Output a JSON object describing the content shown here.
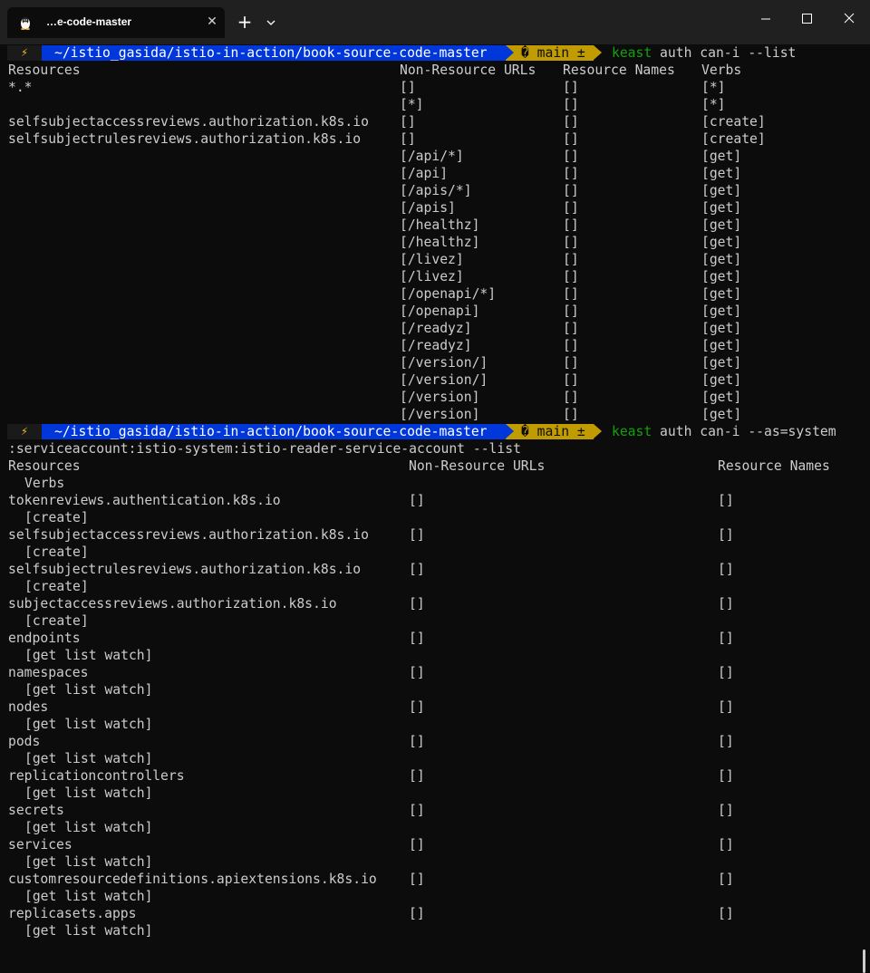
{
  "window": {
    "tab_title": "…e-code-master",
    "tab_icon": "linux-penguin-icon"
  },
  "prompt": {
    "bolt": "⚡",
    "path": "~/istio_gasida/istio-in-action/book-source-code-master",
    "git": "� main ±"
  },
  "cmd1": {
    "keyword": "keast",
    "args": " auth can-i --list"
  },
  "table1": {
    "header": [
      "Resources",
      "Non-Resource URLs",
      "Resource Names",
      "Verbs"
    ],
    "rows": [
      [
        "*.*",
        "[]",
        "[]",
        "[*]"
      ],
      [
        "",
        "[*]",
        "[]",
        "[*]"
      ],
      [
        "selfsubjectaccessreviews.authorization.k8s.io",
        "[]",
        "[]",
        "[create]"
      ],
      [
        "selfsubjectrulesreviews.authorization.k8s.io",
        "[]",
        "[]",
        "[create]"
      ],
      [
        "",
        "[/api/*]",
        "[]",
        "[get]"
      ],
      [
        "",
        "[/api]",
        "[]",
        "[get]"
      ],
      [
        "",
        "[/apis/*]",
        "[]",
        "[get]"
      ],
      [
        "",
        "[/apis]",
        "[]",
        "[get]"
      ],
      [
        "",
        "[/healthz]",
        "[]",
        "[get]"
      ],
      [
        "",
        "[/healthz]",
        "[]",
        "[get]"
      ],
      [
        "",
        "[/livez]",
        "[]",
        "[get]"
      ],
      [
        "",
        "[/livez]",
        "[]",
        "[get]"
      ],
      [
        "",
        "[/openapi/*]",
        "[]",
        "[get]"
      ],
      [
        "",
        "[/openapi]",
        "[]",
        "[get]"
      ],
      [
        "",
        "[/readyz]",
        "[]",
        "[get]"
      ],
      [
        "",
        "[/readyz]",
        "[]",
        "[get]"
      ],
      [
        "",
        "[/version/]",
        "[]",
        "[get]"
      ],
      [
        "",
        "[/version/]",
        "[]",
        "[get]"
      ],
      [
        "",
        "[/version]",
        "[]",
        "[get]"
      ],
      [
        "",
        "[/version]",
        "[]",
        "[get]"
      ]
    ]
  },
  "cmd2": {
    "keyword": "keast",
    "args": " auth can-i --as=system",
    "continuation": ":serviceaccount:istio-system:istio-reader-service-account --list"
  },
  "table2": {
    "header": [
      "Resources",
      "Non-Resource URLs",
      "Resource Names",
      "Verbs"
    ],
    "rows": [
      [
        "tokenreviews.authentication.k8s.io",
        "[]",
        "[]",
        "[create]"
      ],
      [
        "selfsubjectaccessreviews.authorization.k8s.io",
        "[]",
        "[]",
        "[create]"
      ],
      [
        "selfsubjectrulesreviews.authorization.k8s.io",
        "[]",
        "[]",
        "[create]"
      ],
      [
        "subjectaccessreviews.authorization.k8s.io",
        "[]",
        "[]",
        "[create]"
      ],
      [
        "endpoints",
        "[]",
        "[]",
        "[get list watch]"
      ],
      [
        "namespaces",
        "[]",
        "[]",
        "[get list watch]"
      ],
      [
        "nodes",
        "[]",
        "[]",
        "[get list watch]"
      ],
      [
        "pods",
        "[]",
        "[]",
        "[get list watch]"
      ],
      [
        "replicationcontrollers",
        "[]",
        "[]",
        "[get list watch]"
      ],
      [
        "secrets",
        "[]",
        "[]",
        "[get list watch]"
      ],
      [
        "services",
        "[]",
        "[]",
        "[get list watch]"
      ],
      [
        "customresourcedefinitions.apiextensions.k8s.io",
        "[]",
        "[]",
        "[get list watch]"
      ],
      [
        "replicasets.apps",
        "[]",
        "[]",
        "[get list watch]"
      ]
    ]
  },
  "colors": {
    "background": "#0c0c0c",
    "text": "#cccccc",
    "path_segment": "#0037da",
    "git_segment": "#c19c00",
    "keyword": "#13a10e"
  }
}
